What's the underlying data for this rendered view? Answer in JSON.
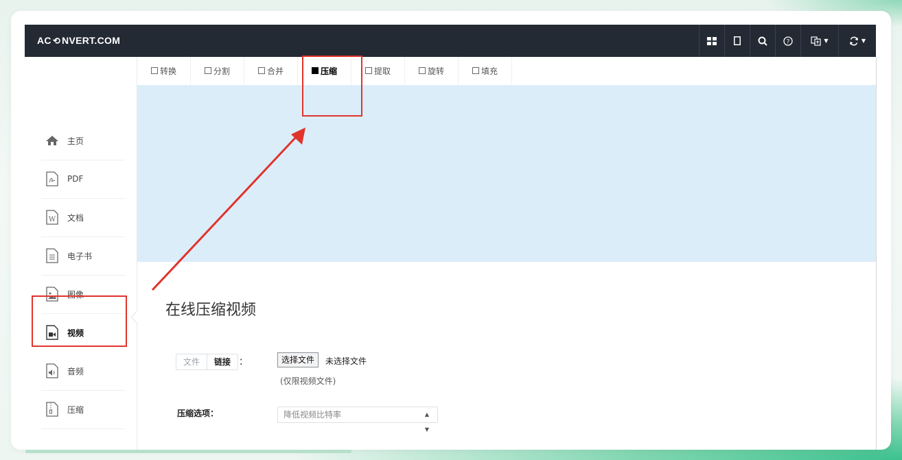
{
  "app": {
    "logo_text_left": "AC",
    "logo_text_right": "NVERT.COM"
  },
  "toolbar": {
    "buttons": [
      {
        "name": "grid-icon",
        "glyph": "▦"
      },
      {
        "name": "bookmark-icon",
        "glyph": "☐"
      },
      {
        "name": "search-icon",
        "glyph": "🔍"
      },
      {
        "name": "help-icon",
        "glyph": "?"
      },
      {
        "name": "language-icon",
        "glyph": "⽂"
      },
      {
        "name": "refresh-icon",
        "glyph": "↻"
      }
    ]
  },
  "sidebar": {
    "items": [
      {
        "label": "主页",
        "icon": "home-icon"
      },
      {
        "label": "PDF",
        "icon": "pdf-file-icon"
      },
      {
        "label": "文档",
        "icon": "word-doc-icon"
      },
      {
        "label": "电子书",
        "icon": "ebook-icon"
      },
      {
        "label": "图像",
        "icon": "image-icon"
      },
      {
        "label": "视频",
        "icon": "video-icon"
      },
      {
        "label": "音频",
        "icon": "audio-icon"
      },
      {
        "label": "压缩",
        "icon": "archive-icon"
      }
    ],
    "active_index": 5
  },
  "tabs": [
    {
      "label": "转换"
    },
    {
      "label": "分割"
    },
    {
      "label": "合并"
    },
    {
      "label": "压缩"
    },
    {
      "label": "提取"
    },
    {
      "label": "旋转"
    },
    {
      "label": "填充"
    }
  ],
  "active_tab_index": 3,
  "main": {
    "title": "在线压缩视频",
    "source_tabs": [
      "文件",
      "链接"
    ],
    "colon": "：",
    "choose_file_label": "选择文件",
    "file_status": "未选择文件",
    "file_hint": "(仅限视频文件)",
    "compress_options_label": "压缩选项：",
    "compress_option_selected": "降低视频比特率"
  },
  "colors": {
    "topbar": "#232a34",
    "banner": "#dcedfa",
    "annotation": "#e0332b"
  }
}
